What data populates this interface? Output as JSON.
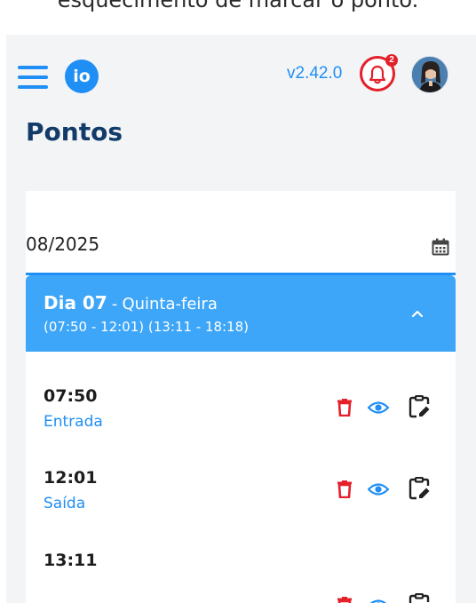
{
  "caption": "esquecimento de marcar o ponto.",
  "header": {
    "logo_text": "io",
    "version": "v2.42.0",
    "notification_count": "2"
  },
  "page": {
    "title": "Pontos"
  },
  "date_filter": {
    "value": "08/2025"
  },
  "day": {
    "label": "Dia 07",
    "separator": "-",
    "weekday": "Quinta-feira",
    "range": "(07:50 - 12:01) (13:11 - 18:18)",
    "expanded": true,
    "entries": [
      {
        "time": "07:50",
        "type": "Entrada"
      },
      {
        "time": "12:01",
        "type": "Saída"
      },
      {
        "time": "13:11",
        "type": ""
      }
    ]
  },
  "colors": {
    "accent": "#1f8ff5",
    "header_blue": "#3ea6f8",
    "title": "#123b6a",
    "delete": "#e4202a"
  },
  "icons": [
    "menu-icon",
    "bell-icon",
    "calendar-icon",
    "chevron-up-icon",
    "trash-icon",
    "eye-icon",
    "clipboard-edit-icon"
  ]
}
